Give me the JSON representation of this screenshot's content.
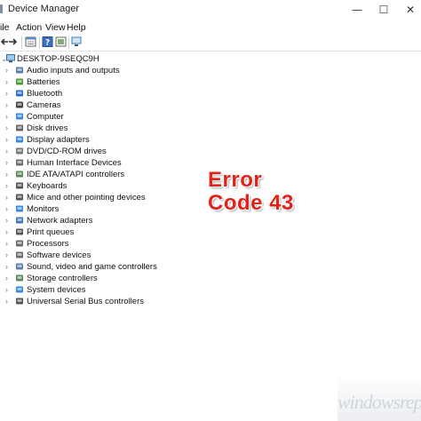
{
  "window": {
    "title": "Device Manager",
    "buttons": {
      "minimize": "—",
      "maximize": "☐",
      "close": "✕"
    }
  },
  "menu": [
    "ile",
    "Action",
    "View",
    "Help"
  ],
  "toolbar": [
    "back-icon",
    "forward-icon",
    "properties-icon",
    "help-icon",
    "show-hidden-icon",
    "scan-icon"
  ],
  "tree": {
    "root": "DESKTOP-9SEQC9H",
    "items": [
      {
        "label": "Audio inputs and outputs",
        "icon": "speaker-icon",
        "color": "#5a7ea8"
      },
      {
        "label": "Batteries",
        "icon": "battery-icon",
        "color": "#4a9a3a"
      },
      {
        "label": "Bluetooth",
        "icon": "bluetooth-icon",
        "color": "#1f6fd0"
      },
      {
        "label": "Cameras",
        "icon": "camera-icon",
        "color": "#444444"
      },
      {
        "label": "Computer",
        "icon": "monitor-icon",
        "color": "#3a8ad8"
      },
      {
        "label": "Disk drives",
        "icon": "disk-icon",
        "color": "#666666"
      },
      {
        "label": "Display adapters",
        "icon": "display-adapter-icon",
        "color": "#3a8ad8"
      },
      {
        "label": "DVD/CD-ROM drives",
        "icon": "dvd-icon",
        "color": "#777777"
      },
      {
        "label": "Human Interface Devices",
        "icon": "hid-icon",
        "color": "#6a6a6a"
      },
      {
        "label": "IDE ATA/ATAPI controllers",
        "icon": "ide-icon",
        "color": "#5a8a5a"
      },
      {
        "label": "Keyboards",
        "icon": "keyboard-icon",
        "color": "#555555"
      },
      {
        "label": "Mice and other pointing devices",
        "icon": "mouse-icon",
        "color": "#555555"
      },
      {
        "label": "Monitors",
        "icon": "monitor-icon",
        "color": "#3a8ad8"
      },
      {
        "label": "Network adapters",
        "icon": "network-icon",
        "color": "#3a7ab8"
      },
      {
        "label": "Print queues",
        "icon": "printer-icon",
        "color": "#555555"
      },
      {
        "label": "Processors",
        "icon": "processor-icon",
        "color": "#6a6a6a"
      },
      {
        "label": "Software devices",
        "icon": "software-device-icon",
        "color": "#6a6a6a"
      },
      {
        "label": "Sound, video and game controllers",
        "icon": "sound-icon",
        "color": "#5a7ea8"
      },
      {
        "label": "Storage controllers",
        "icon": "storage-icon",
        "color": "#5a8a5a"
      },
      {
        "label": "System devices",
        "icon": "system-device-icon",
        "color": "#3a8ad8"
      },
      {
        "label": "Universal Serial Bus controllers",
        "icon": "usb-icon",
        "color": "#555555"
      }
    ]
  },
  "overlay": {
    "line1": "Error",
    "line2": "Code 43",
    "color": "#e2231a"
  },
  "watermark": "windowsreport"
}
